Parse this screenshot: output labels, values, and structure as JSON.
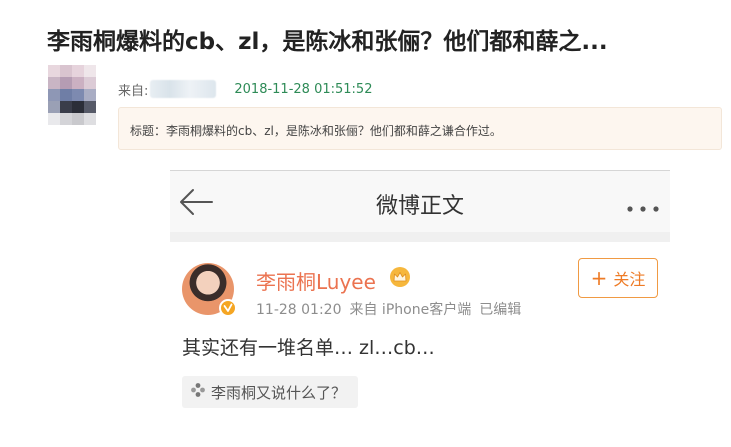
{
  "post": {
    "title": "李雨桐爆料的cb、zl，是陈冰和张俪？他们都和薛之...",
    "meta": {
      "from_label": "来自:",
      "timestamp": "2018-11-28 01:51:52"
    },
    "subject": "标题：李雨桐爆料的cb、zl，是陈冰和张俪？他们都和薛之谦合作过。"
  },
  "screenshot": {
    "header": {
      "title": "微博正文",
      "back_icon": "arrow-left-icon",
      "more_icon": "more-dots-icon"
    },
    "card": {
      "user_name": "李雨桐Luyee",
      "time": "11-28 01:20",
      "source": "来自 iPhone客户端",
      "edited": "已编辑",
      "follow_label": "关注",
      "body": "其实还有一堆名单… zl…cb…",
      "topic": "李雨桐又说什么了？"
    }
  },
  "colors": {
    "timestamp": "#2e8b57",
    "username": "#eb7350",
    "follow": "#ee7b26",
    "subject_bg": "#fdf6ef"
  }
}
